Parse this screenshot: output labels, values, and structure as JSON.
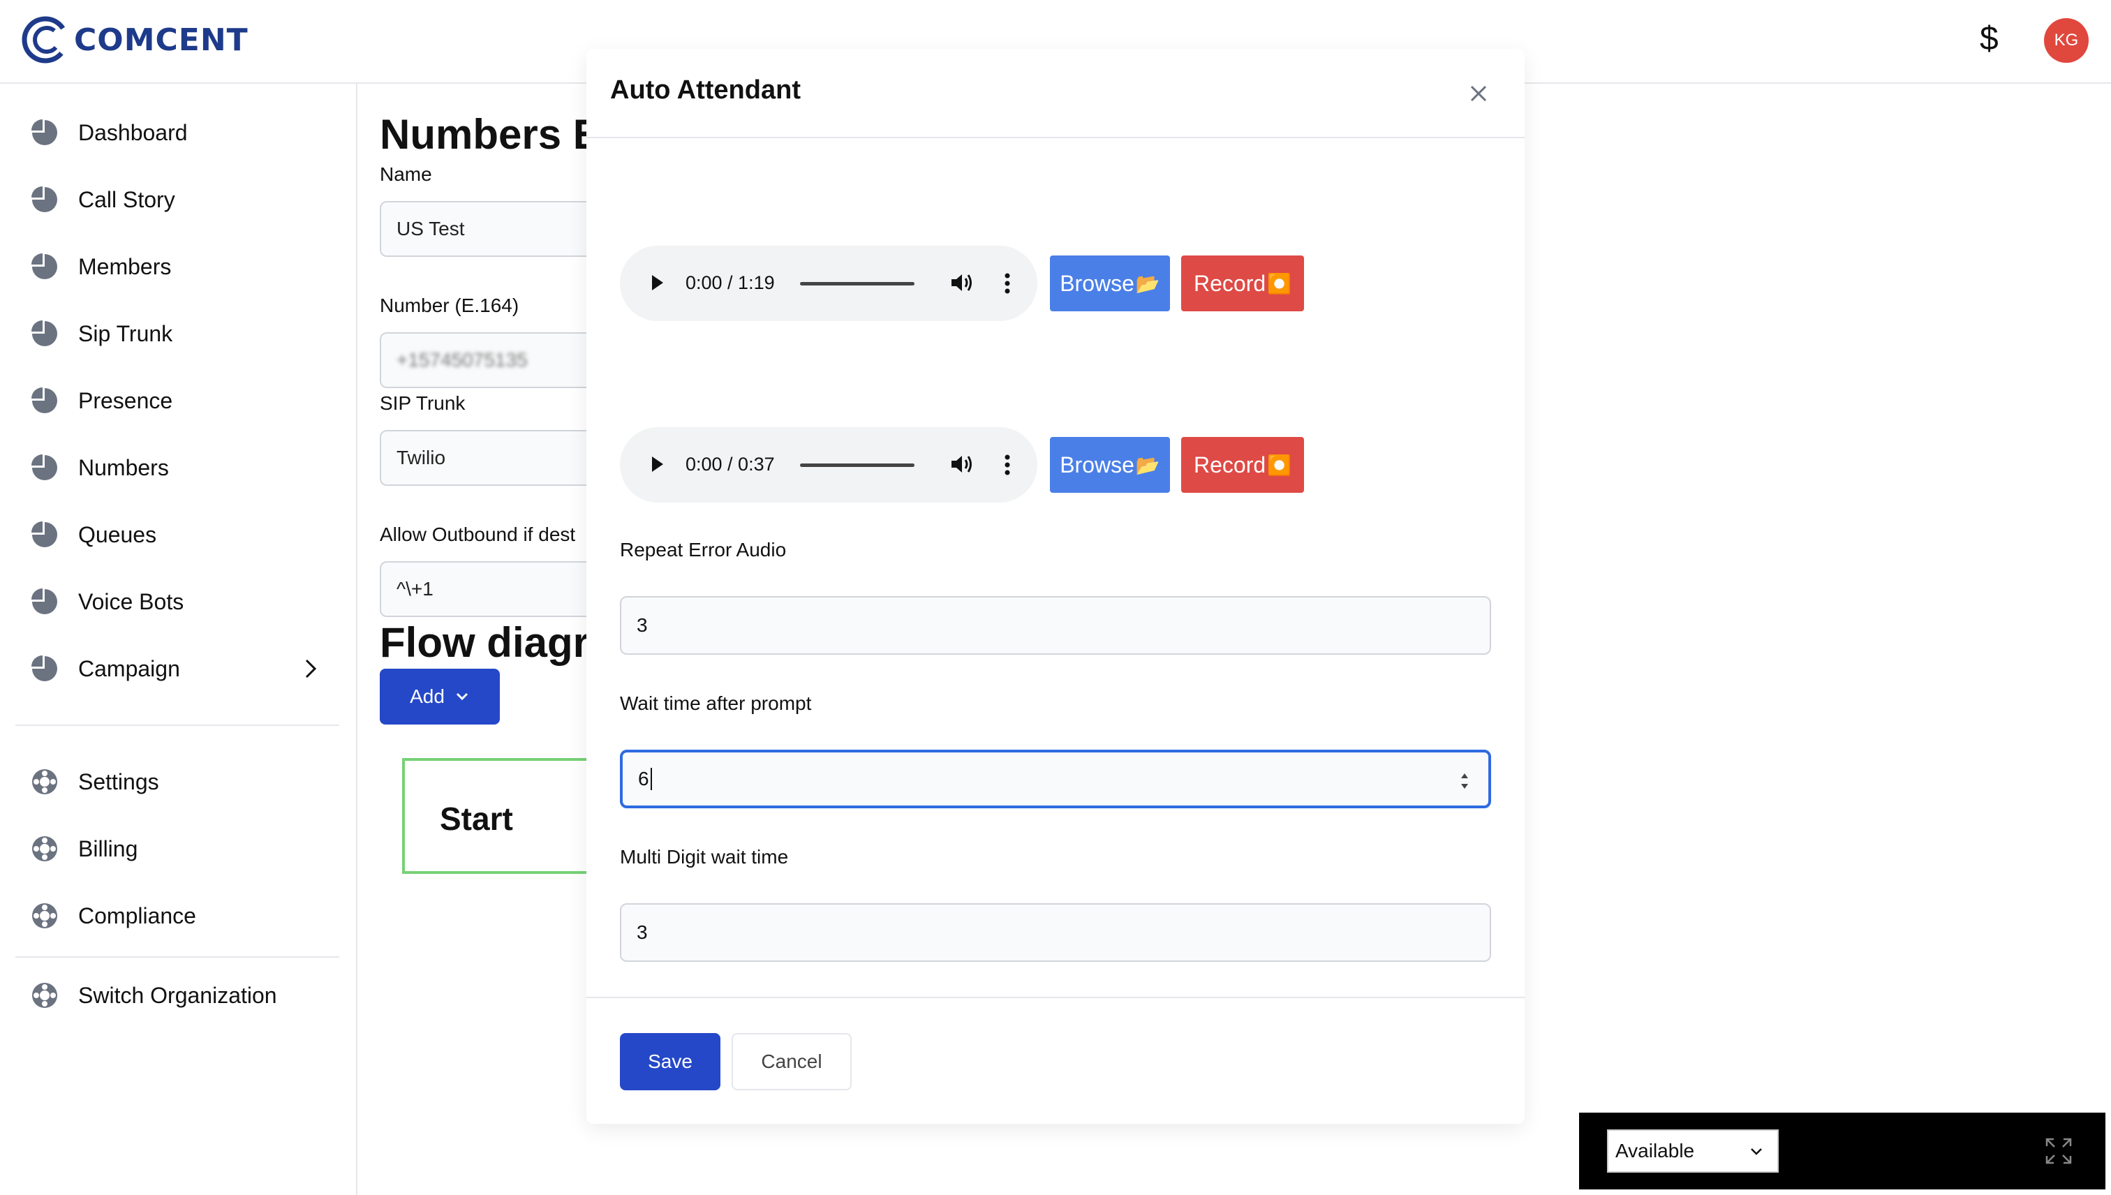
{
  "header": {
    "brand": "COMCENT",
    "currency_symbol": "$",
    "avatar_initials": "KG"
  },
  "sidebar": {
    "items": [
      {
        "label": "Dashboard"
      },
      {
        "label": "Call Story"
      },
      {
        "label": "Members"
      },
      {
        "label": "Sip Trunk"
      },
      {
        "label": "Presence"
      },
      {
        "label": "Numbers"
      },
      {
        "label": "Queues"
      },
      {
        "label": "Voice Bots"
      },
      {
        "label": "Campaign"
      }
    ],
    "secondary": [
      {
        "label": "Settings"
      },
      {
        "label": "Billing"
      },
      {
        "label": "Compliance"
      }
    ],
    "footer": [
      {
        "label": "Switch Organization"
      }
    ]
  },
  "main": {
    "title": "Numbers E",
    "name_label": "Name",
    "name_value": "US Test",
    "number_label": "Number (E.164)",
    "number_value": "+15745075135",
    "sip_label": "SIP Trunk",
    "sip_value": "Twilio",
    "outbound_label": "Allow Outbound if dest",
    "outbound_value": "^\\+1",
    "flow_title": "Flow diagra",
    "add_label": "Add",
    "start_node": "Start"
  },
  "modal": {
    "title": "Auto Attendant",
    "audio": [
      {
        "time": "0:00 / 1:19"
      },
      {
        "time": "0:00 / 0:37"
      }
    ],
    "browse_label": "Browse",
    "browse_emoji": "📂",
    "record_label": "Record",
    "record_emoji": "⏺️",
    "repeat_error_label": "Repeat Error Audio",
    "repeat_error_value": "3",
    "wait_time_label": "Wait time after prompt",
    "wait_time_value": "6",
    "multi_digit_label": "Multi Digit wait time",
    "multi_digit_value": "3",
    "save_label": "Save",
    "cancel_label": "Cancel"
  },
  "softphone": {
    "status": "Available"
  },
  "colors": {
    "primary": "#2548c8",
    "browse": "#4a7fe7",
    "record": "#de4a45",
    "brand": "#1e3a8a",
    "avatar": "#e0473d",
    "focus": "#2f6be0"
  }
}
